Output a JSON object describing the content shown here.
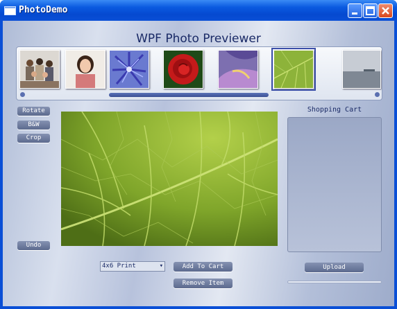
{
  "window": {
    "title": "PhotoDemo"
  },
  "app": {
    "title": "WPF Photo Previewer"
  },
  "filmstrip": {
    "thumbnails": [
      {
        "subject": "family-group"
      },
      {
        "subject": "woman-portrait"
      },
      {
        "subject": "blue-flowers"
      },
      {
        "subject": "red-rose"
      },
      {
        "subject": "purple-petals"
      },
      {
        "subject": "green-leaf",
        "selected": true
      },
      {
        "subject": "grey-seascape"
      }
    ]
  },
  "tools": {
    "rotate": "Rotate",
    "bw": "B&W",
    "crop": "Crop",
    "undo": "Undo"
  },
  "cart": {
    "title": "Shopping Cart",
    "upload": "Upload",
    "upload_progress": 0
  },
  "order": {
    "print_size": "4x6 Print",
    "add_to_cart": "Add To Cart",
    "remove_item": "Remove Item"
  }
}
